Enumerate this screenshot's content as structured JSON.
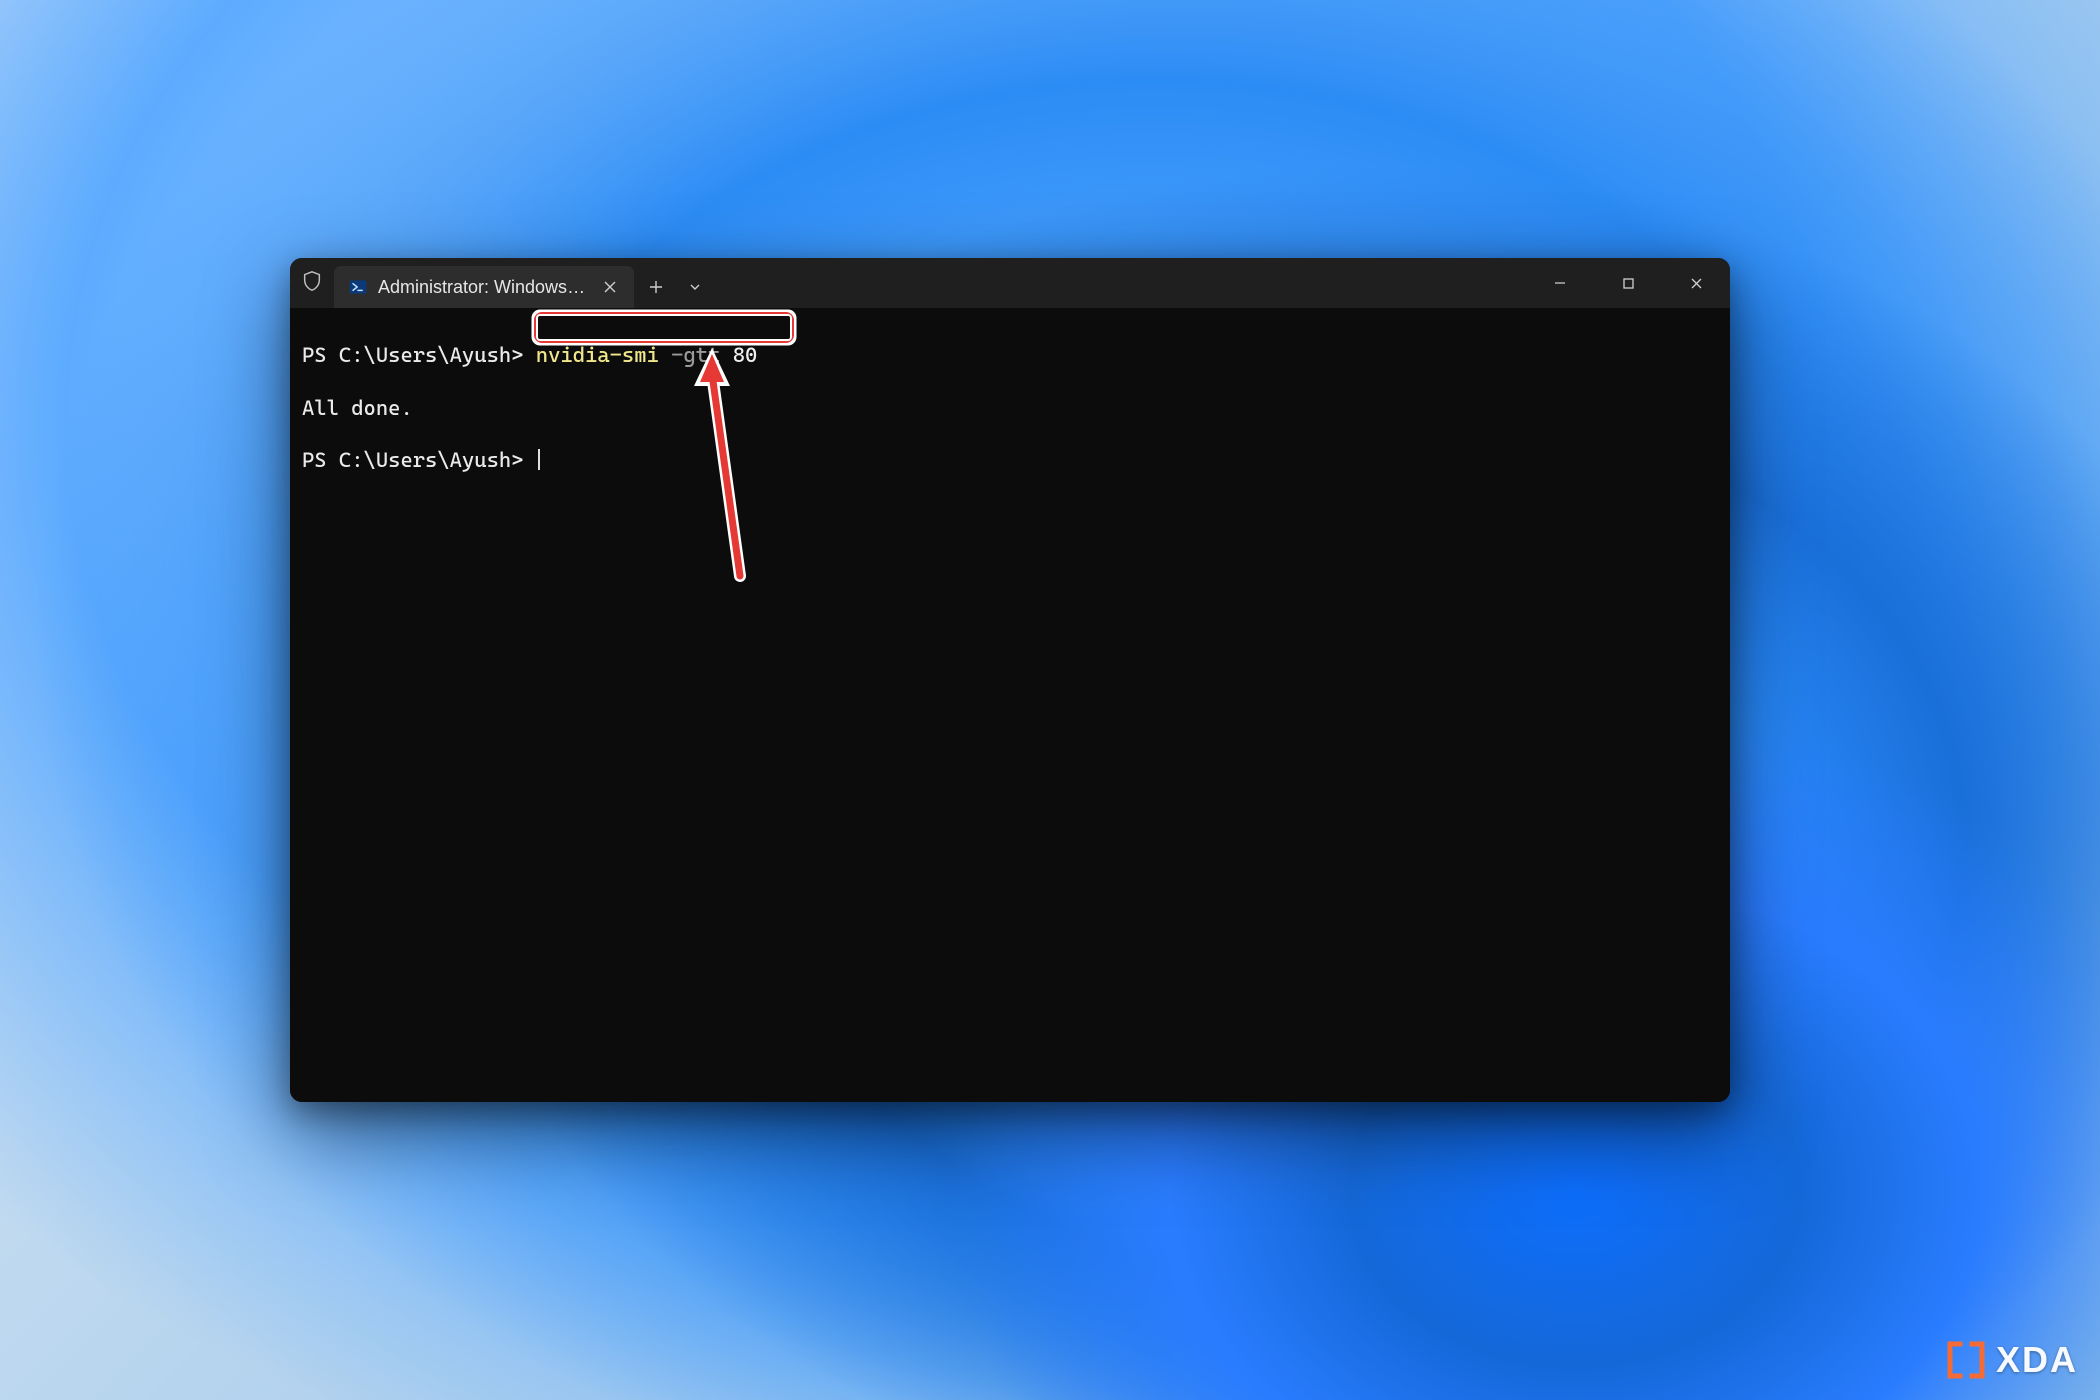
{
  "titlebar": {
    "tab_title": "Administrator: Windows Powe",
    "icons": {
      "shield": "shield-icon",
      "powershell": "powershell-icon",
      "close_tab": "close-icon",
      "new_tab": "plus-icon",
      "dropdown": "chevron-down-icon",
      "minimize": "minimize-icon",
      "maximize": "maximize-icon",
      "close_win": "close-icon"
    }
  },
  "terminal": {
    "lines": [
      {
        "prompt": "PS C:\\Users\\Ayush>",
        "cmd_exe": "nvidia-smi",
        "cmd_flag": "-gtt",
        "cmd_arg": "80"
      },
      {
        "text": "All done."
      },
      {
        "prompt": "PS C:\\Users\\Ayush>",
        "cursor": true
      }
    ]
  },
  "annotation": {
    "highlight_target": "nvidia-smi -gtt 80",
    "arrow_color": "#e53935",
    "arrow_stroke": "#ffffff"
  },
  "watermark": {
    "text": "XDA",
    "bracket_color": "#ff6a2b"
  }
}
